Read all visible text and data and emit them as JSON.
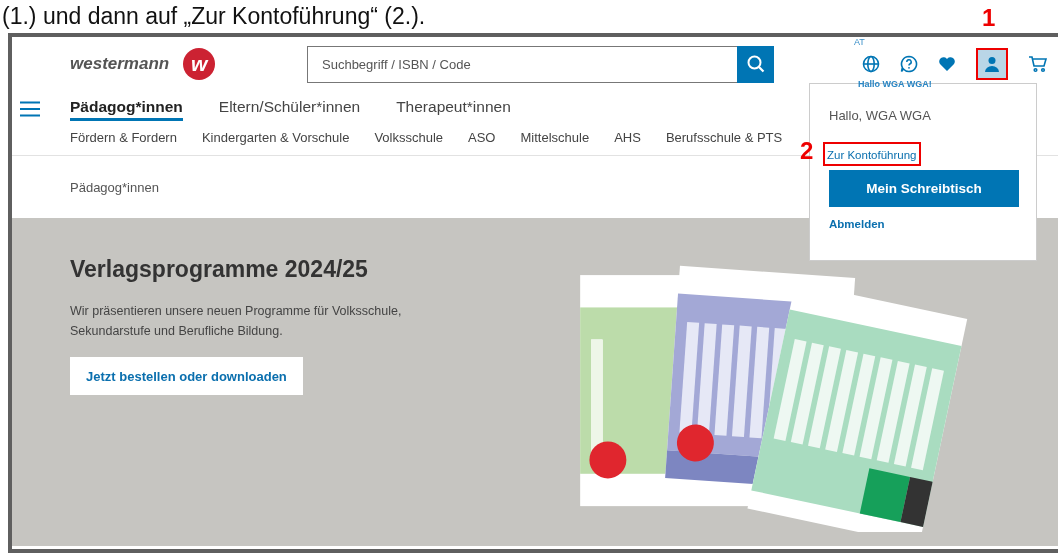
{
  "caption": "(1.) und dann auf „Zur Kontoführung“ (2.).",
  "header": {
    "logo": "westermann",
    "logo_mark": "w",
    "search": {
      "placeholder": "Suchbegriff / ISBN / Code"
    },
    "region": "AT",
    "greeting": "Hallo WGA WGA!"
  },
  "audience_tabs": [
    {
      "label": "Pädagog*innen",
      "selected": true
    },
    {
      "label": "Eltern/Schüler*innen",
      "selected": false
    },
    {
      "label": "Therapeut*innen",
      "selected": false
    }
  ],
  "school_links": [
    "Fördern & Fordern",
    "Kindergarten & Vorschule",
    "Volksschule",
    "ASO",
    "Mittelschule",
    "AHS",
    "Berufsschule & PTS"
  ],
  "breadcrumb": "Pädagog*innen",
  "banner": {
    "title": "Verlagsprogramme 2024/25",
    "text": "Wir präsentieren unsere neuen Programme für Volksschule, Sekundarstufe und Berufliche Bildung.",
    "button": "Jetzt bestellen oder downloaden"
  },
  "account_menu": {
    "greeting": "Hallo, WGA WGA",
    "items": [
      {
        "kind": "link",
        "label": "Zur Kontoführung"
      },
      {
        "kind": "button",
        "label": "Mein Schreibtisch"
      },
      {
        "kind": "link",
        "label": "Abmelden"
      }
    ]
  },
  "annotations": [
    {
      "number": "1"
    },
    {
      "number": "2"
    }
  ]
}
